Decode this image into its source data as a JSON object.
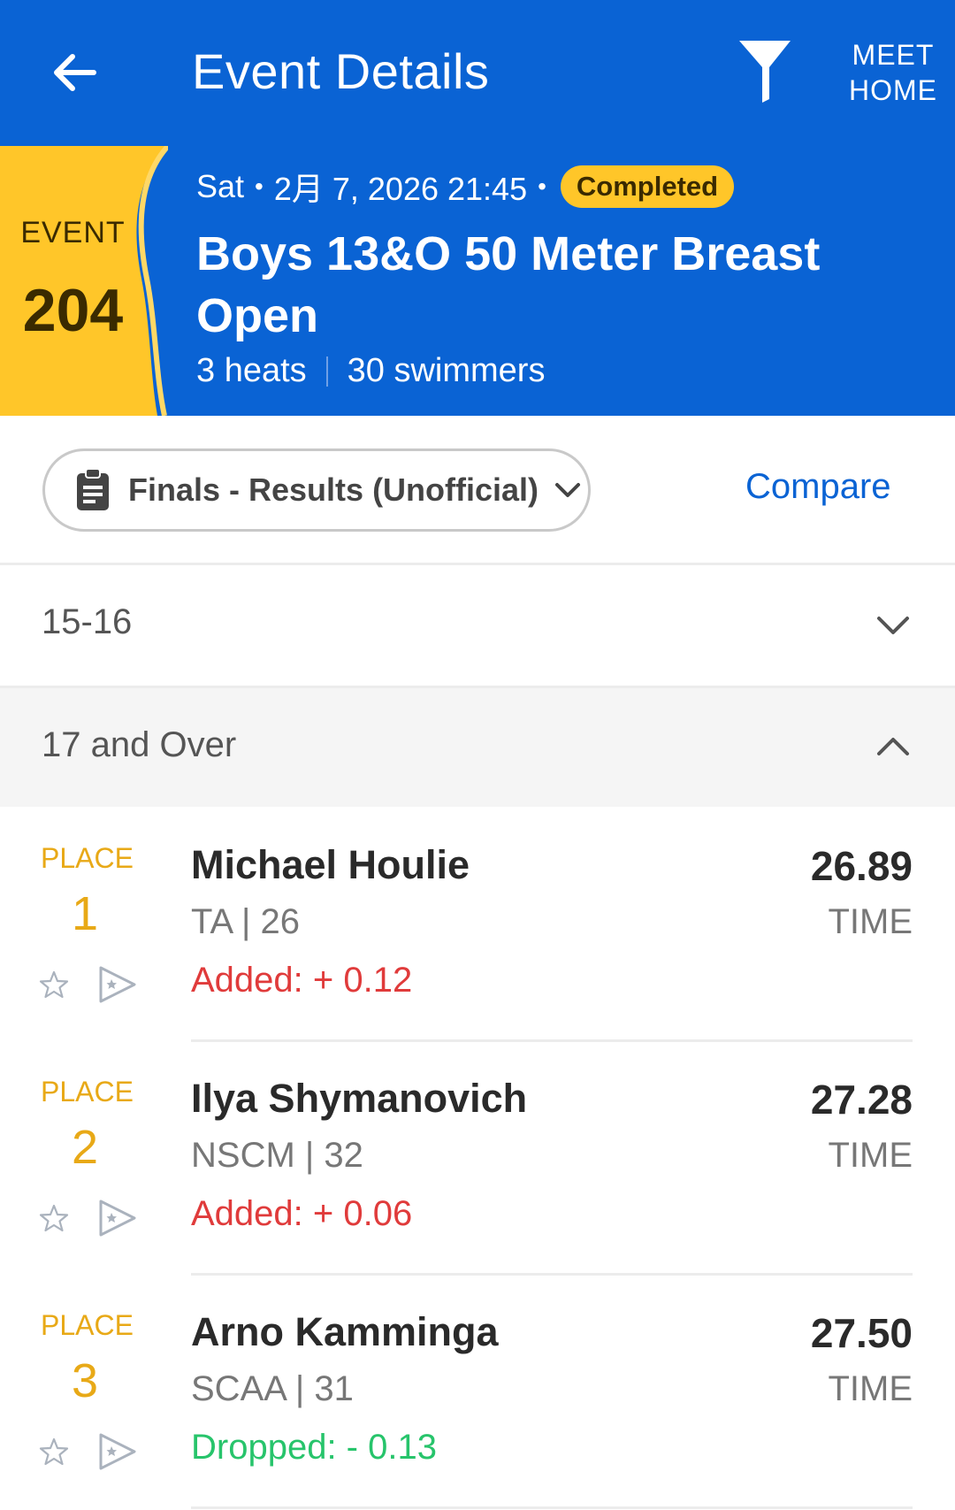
{
  "header": {
    "title": "Event Details",
    "back_icon": "arrow-left-icon",
    "filter_icon": "filter-icon",
    "meet_home_label_line1": "MEET",
    "meet_home_label_line2": "HOME",
    "background_color": "#0a63d4"
  },
  "event": {
    "label": "EVENT",
    "number": "204",
    "badge_color": "#ffc629",
    "day": "Sat",
    "datetime": "2月 7, 2026 21:45",
    "status": "Completed",
    "name": "Boys 13&O 50 Meter Breast Open",
    "heats": "3 heats",
    "swimmers": "30 swimmers"
  },
  "controls": {
    "round_select": "Finals - Results (Unofficial)",
    "compare": "Compare"
  },
  "groups": [
    {
      "label": "15-16",
      "expanded": false
    },
    {
      "label": "17 and Over",
      "expanded": true
    }
  ],
  "results": [
    {
      "place_label": "PLACE",
      "place": "1",
      "name": "Michael Houlie",
      "team_age": "TA | 26",
      "diff": "Added: + 0.12",
      "diff_type": "added",
      "time": "26.89",
      "time_label": "TIME"
    },
    {
      "place_label": "PLACE",
      "place": "2",
      "name": "Ilya Shymanovich",
      "team_age": "NSCM | 32",
      "diff": "Added: + 0.06",
      "diff_type": "added",
      "time": "27.28",
      "time_label": "TIME"
    },
    {
      "place_label": "PLACE",
      "place": "3",
      "name": "Arno Kamminga",
      "team_age": "SCAA | 31",
      "diff": "Dropped: - 0.13",
      "diff_type": "dropped",
      "time": "27.50",
      "time_label": "TIME"
    }
  ],
  "colors": {
    "place": "#e8a917",
    "added": "#e03b3b",
    "dropped": "#27c46b",
    "link": "#0a63d4"
  }
}
